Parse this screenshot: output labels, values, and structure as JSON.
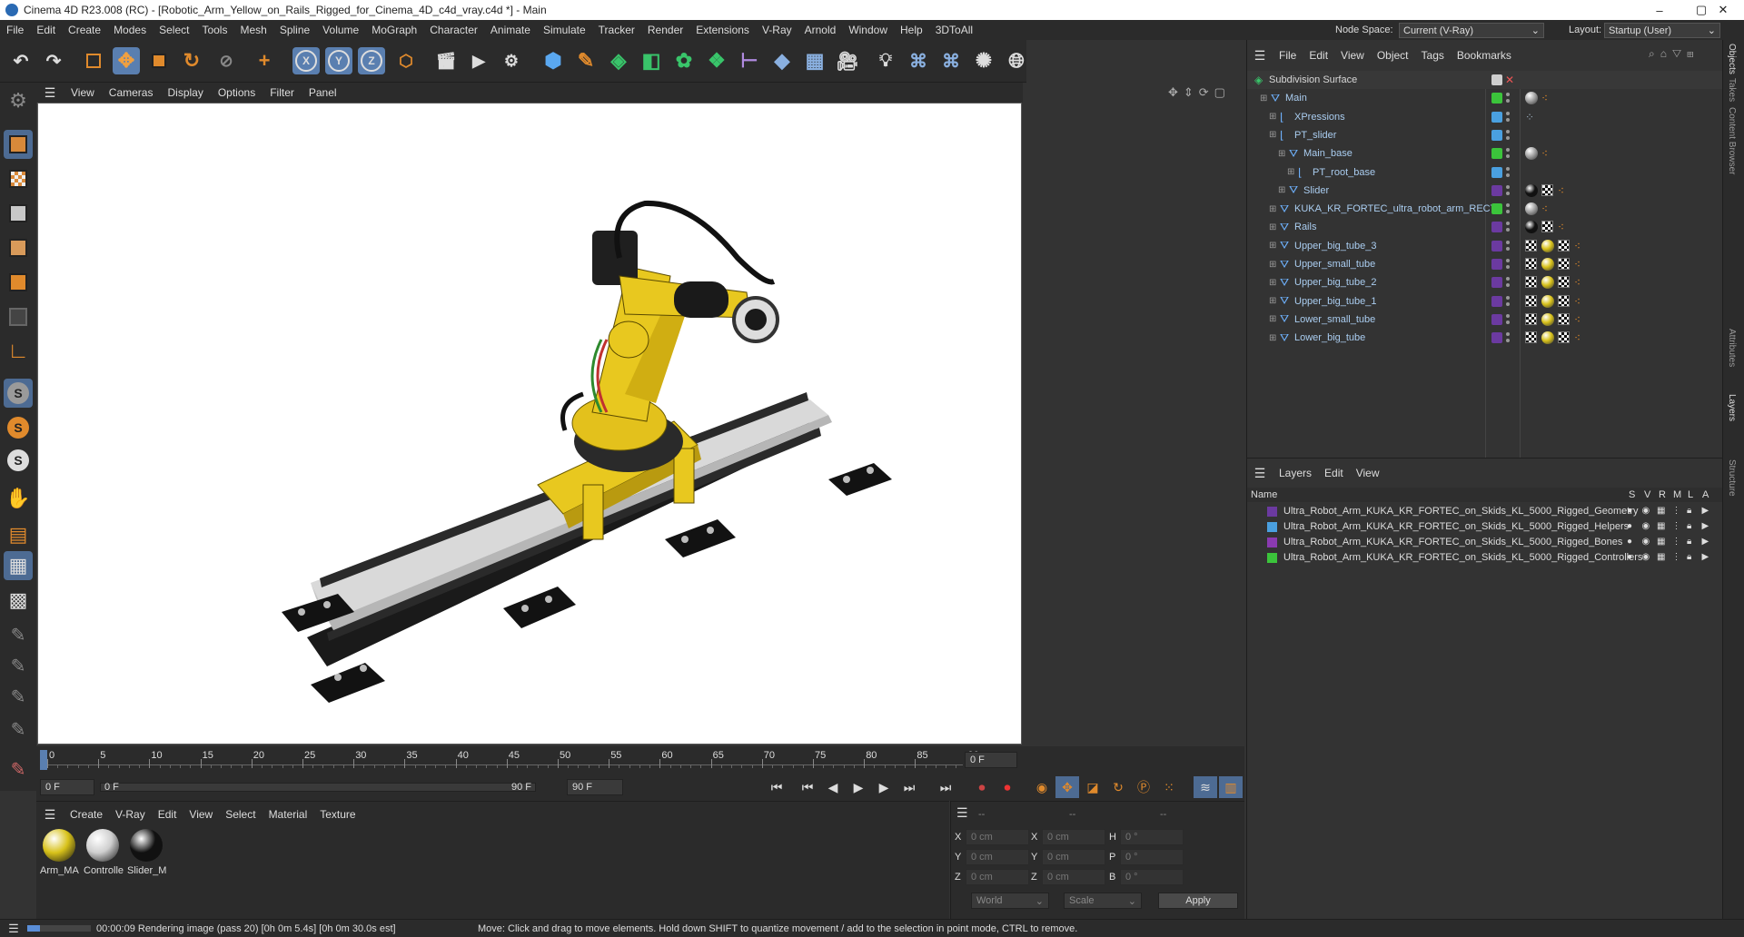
{
  "title": "Cinema 4D R23.008 (RC) - [Robotic_Arm_Yellow_on_Rails_Rigged_for_Cinema_4D_c4d_vray.c4d *] - Main",
  "window_controls": {
    "minimize": "–",
    "maximize": "▢",
    "close": "✕"
  },
  "menubar": [
    "File",
    "Edit",
    "Create",
    "Modes",
    "Select",
    "Tools",
    "Mesh",
    "Spline",
    "Volume",
    "MoGraph",
    "Character",
    "Animate",
    "Simulate",
    "Tracker",
    "Render",
    "Extensions",
    "V-Ray",
    "Arnold",
    "Window",
    "Help",
    "3DToAll"
  ],
  "node_space": {
    "label": "Node Space:",
    "value": "Current (V-Ray)"
  },
  "layout": {
    "label": "Layout:",
    "value": "Startup (User)"
  },
  "toolbar": {
    "axis_x": "X",
    "axis_y": "Y",
    "axis_z": "Z"
  },
  "viewport": {
    "menu": [
      "View",
      "Cameras",
      "Display",
      "Options",
      "Filter",
      "Panel"
    ]
  },
  "timeline": {
    "ticks": [
      "0",
      "5",
      "10",
      "15",
      "20",
      "25",
      "30",
      "35",
      "40",
      "45",
      "50",
      "55",
      "60",
      "65",
      "70",
      "75",
      "80",
      "85",
      "90"
    ],
    "current_frame_right": "0 F",
    "start_field": "0 F",
    "current_field": "0 F",
    "end_field_inner": "90 F",
    "end_field": "90 F"
  },
  "materials": {
    "menu": [
      "Create",
      "V-Ray",
      "Edit",
      "View",
      "Select",
      "Material",
      "Texture"
    ],
    "items": [
      {
        "name": "Arm_MA",
        "color": "#d8c21a"
      },
      {
        "name": "Controlle",
        "color": "#cfcfcf"
      },
      {
        "name": "Slider_M",
        "color": "#111111"
      }
    ]
  },
  "coords": {
    "headers": [
      "--",
      "--",
      "--"
    ],
    "rows": [
      {
        "a_label": "X",
        "a_value": "0 cm",
        "b_label": "X",
        "b_value": "0 cm",
        "c_label": "H",
        "c_value": "0 °"
      },
      {
        "a_label": "Y",
        "a_value": "0 cm",
        "b_label": "Y",
        "b_value": "0 cm",
        "c_label": "P",
        "c_value": "0 °"
      },
      {
        "a_label": "Z",
        "a_value": "0 cm",
        "b_label": "Z",
        "b_value": "0 cm",
        "c_label": "B",
        "c_value": "0 °"
      }
    ],
    "world": "World",
    "scale": "Scale",
    "apply": "Apply"
  },
  "status": {
    "render": "00:00:09 Rendering image (pass 20) [0h  0m  5.4s] [0h  0m 30.0s est]",
    "hint": "Move: Click and drag to move elements. Hold down SHIFT to quantize movement / add to the selection in point mode, CTRL to remove."
  },
  "objects": {
    "menu": [
      "File",
      "Edit",
      "View",
      "Object",
      "Tags",
      "Bookmarks"
    ],
    "rows": [
      {
        "name": "Subdivision Surface",
        "tag": "#cfcfcf"
      },
      {
        "name": "Main",
        "tag": "#3bc43b"
      },
      {
        "name": "XPressions",
        "tag": "#4aa0e0"
      },
      {
        "name": "PT_slider",
        "tag": "#4aa0e0"
      },
      {
        "name": "Main_base",
        "tag": "#3bc43b"
      },
      {
        "name": "PT_root_base",
        "tag": "#4aa0e0"
      },
      {
        "name": "Slider",
        "tag": "#6b3aa0"
      },
      {
        "name": "KUKA_KR_FORTEC_ultra_robot_arm_RECT",
        "tag": "#3bc43b"
      },
      {
        "name": "Rails",
        "tag": "#6b3aa0"
      },
      {
        "name": "Upper_big_tube_3",
        "tag": "#6b3aa0"
      },
      {
        "name": "Upper_small_tube",
        "tag": "#6b3aa0"
      },
      {
        "name": "Upper_big_tube_2",
        "tag": "#6b3aa0"
      },
      {
        "name": "Upper_big_tube_1",
        "tag": "#6b3aa0"
      },
      {
        "name": "Lower_small_tube",
        "tag": "#6b3aa0"
      },
      {
        "name": "Lower_big_tube",
        "tag": "#6b3aa0"
      }
    ]
  },
  "layers": {
    "menu": [
      "Layers",
      "Edit",
      "View"
    ],
    "header": {
      "name": "Name",
      "s": "S",
      "v": "V",
      "r": "R",
      "m": "M",
      "l": "L",
      "a": "A"
    },
    "rows": [
      {
        "name": "Ultra_Robot_Arm_KUKA_KR_FORTEC_on_Skids_KL_5000_Rigged_Geometry",
        "color": "#6b3aa0"
      },
      {
        "name": "Ultra_Robot_Arm_KUKA_KR_FORTEC_on_Skids_KL_5000_Rigged_Helpers",
        "color": "#4aa0e0"
      },
      {
        "name": "Ultra_Robot_Arm_KUKA_KR_FORTEC_on_Skids_KL_5000_Rigged_Bones",
        "color": "#8a3ab0"
      },
      {
        "name": "Ultra_Robot_Arm_KUKA_KR_FORTEC_on_Skids_KL_5000_Rigged_Controllers",
        "color": "#3bc43b"
      }
    ]
  },
  "right_tabs": [
    "Objects",
    "Takes",
    "Content Browser",
    "Attributes",
    "Layers",
    "Structure"
  ]
}
